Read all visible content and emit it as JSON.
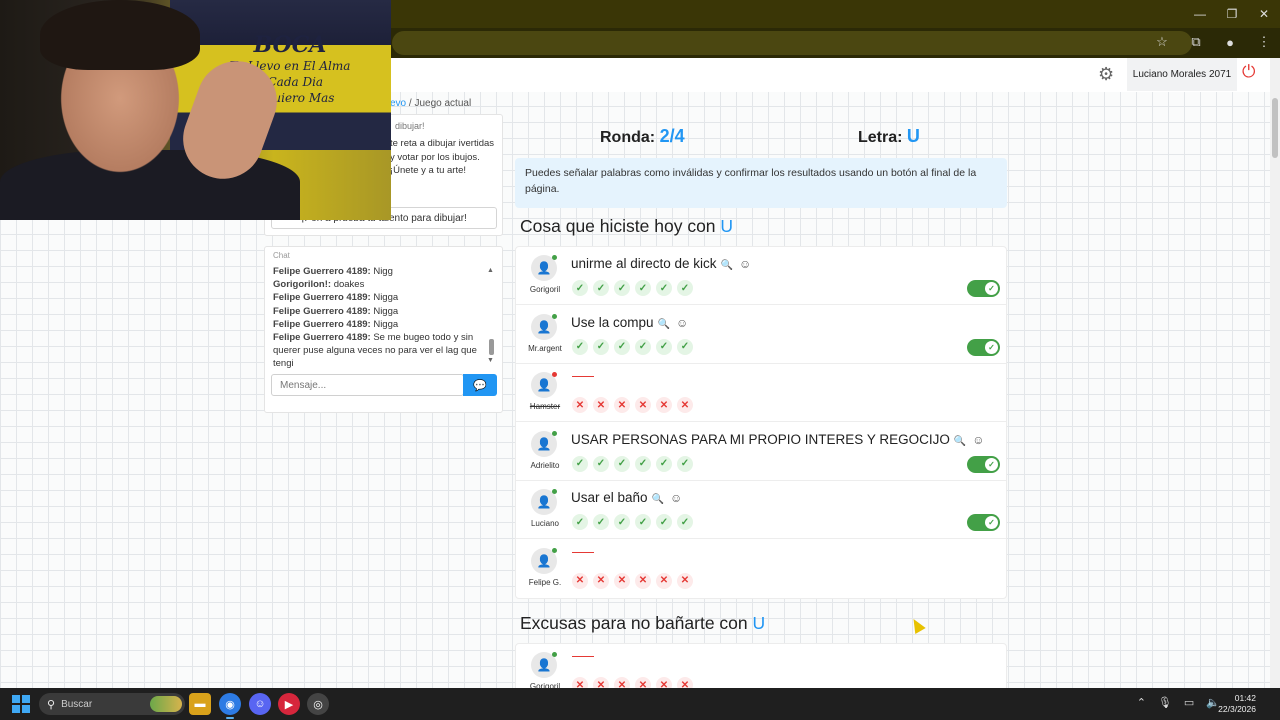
{
  "browser": {
    "window_controls": [
      "—",
      "❐",
      "✕"
    ],
    "toolbar_icons": [
      "star-icon",
      "extensions-icon",
      "profile-icon",
      "menu-icon"
    ]
  },
  "header": {
    "user_label": "Luciano Morales 2071"
  },
  "breadcrumb": {
    "link": "evo",
    "separator": "/",
    "current": "Juego actual"
  },
  "info_panel": {
    "title": "dibujar!",
    "text": "te reta a dibujar ivertidas y votar por los ibujos. ¡Únete y a tu arte!",
    "button": "¡Pon a prueba tu talento para dibujar!"
  },
  "chat": {
    "title": "Chat",
    "messages": [
      {
        "user": "Felipe Guerrero 4189:",
        "text": "Nigg"
      },
      {
        "user": "Gorigorilon!:",
        "text": "doakes"
      },
      {
        "user": "Felipe Guerrero 4189:",
        "text": "Nigga"
      },
      {
        "user": "Felipe Guerrero 4189:",
        "text": "Nigga"
      },
      {
        "user": "Felipe Guerrero 4189:",
        "text": "Nigga"
      },
      {
        "user": "Felipe Guerrero 4189:",
        "text": "Se me bugeo todo y sin querer puse alguna veces no para ver el lag que tengi"
      }
    ],
    "input_placeholder": "Mensaje..."
  },
  "game": {
    "round_label": "Ronda:",
    "round_value": "2/4",
    "letter_label": "Letra:",
    "letter_value": "U",
    "notice": "Puedes señalar palabras como inválidas y confirmar los resultados usando un botón al final de la página."
  },
  "categories": [
    {
      "title": "Cosa que hiciste hoy con",
      "letter": "U",
      "answers": [
        {
          "player": "Gorigoril",
          "answer": "unirme al directo de kick",
          "valid": true,
          "status_color": "#43a047",
          "struck": false
        },
        {
          "player": "Mr.argent",
          "answer": "Use la compu",
          "valid": true,
          "status_color": "#43a047",
          "struck": false
        },
        {
          "player": "Hamster",
          "answer": "",
          "valid": false,
          "status_color": "#e53935",
          "struck": true
        },
        {
          "player": "Adrielito",
          "answer": "USAR PERSONAS PARA MI PROPIO INTERES Y REGOCIJO",
          "valid": true,
          "status_color": "#43a047",
          "struck": false
        },
        {
          "player": "Luciano",
          "answer": "Usar el baño",
          "valid": true,
          "status_color": "#43a047",
          "struck": false
        },
        {
          "player": "Felipe G.",
          "answer": "",
          "valid": false,
          "status_color": "#43a047",
          "struck": false
        }
      ]
    },
    {
      "title": "Excusas para no bañarte con",
      "letter": "U",
      "answers": [
        {
          "player": "Gorigoril",
          "answer": "",
          "valid": false,
          "status_color": "#43a047",
          "struck": false
        }
      ]
    }
  ],
  "webcam": {
    "flag_line1": "BOCA",
    "flag_line2": "Te Llevo en El Alma",
    "flag_line3": "y Cada Dia",
    "flag_line4": "Te Quiero Mas"
  },
  "taskbar": {
    "search_placeholder": "Buscar",
    "time": "01:42",
    "date": "22/3/2026"
  },
  "colors": {
    "accent": "#2196f3",
    "valid": "#43a047",
    "invalid": "#e53935"
  }
}
